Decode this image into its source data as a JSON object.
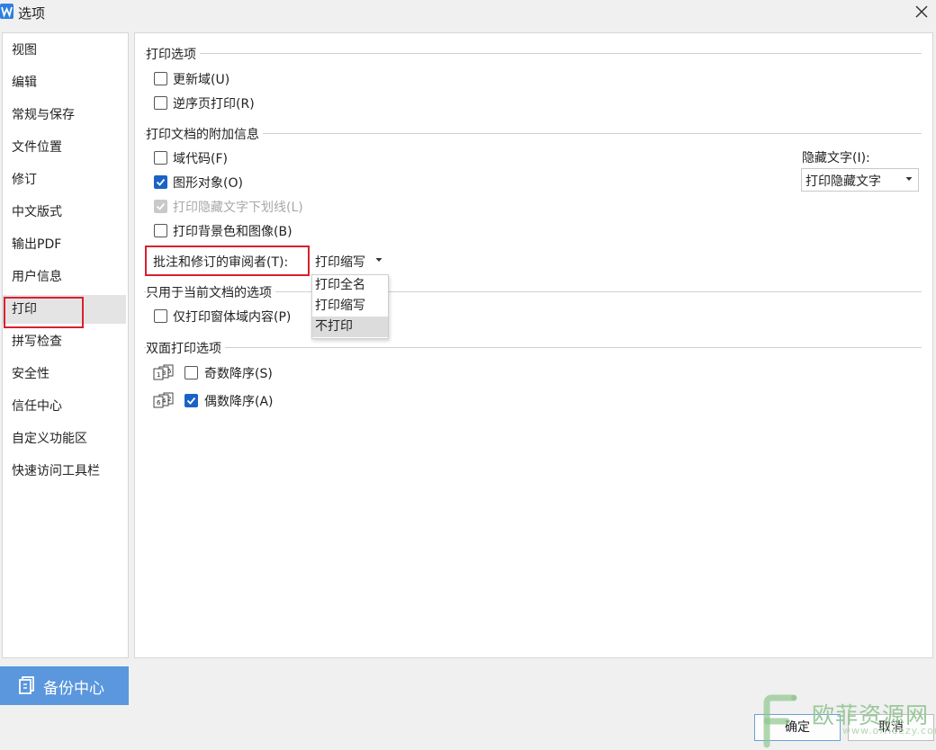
{
  "window": {
    "title": "选项"
  },
  "sidebar": {
    "items": [
      {
        "label": "视图"
      },
      {
        "label": "编辑"
      },
      {
        "label": "常规与保存"
      },
      {
        "label": "文件位置"
      },
      {
        "label": "修订"
      },
      {
        "label": "中文版式"
      },
      {
        "label": "输出PDF"
      },
      {
        "label": "用户信息"
      },
      {
        "label": "打印",
        "selected": true
      },
      {
        "label": "拼写检查"
      },
      {
        "label": "安全性"
      },
      {
        "label": "信任中心"
      },
      {
        "label": "自定义功能区"
      },
      {
        "label": "快速访问工具栏"
      }
    ],
    "backup_label": "备份中心"
  },
  "print_options": {
    "title": "打印选项",
    "update_fields": {
      "label": "更新域(U)",
      "checked": false
    },
    "reverse_order": {
      "label": "逆序页打印(R)",
      "checked": false
    }
  },
  "extra_info": {
    "title": "打印文档的附加信息",
    "field_codes": {
      "label": "域代码(F)",
      "checked": false
    },
    "drawing_objects": {
      "label": "图形对象(O)",
      "checked": true
    },
    "hidden_underline": {
      "label": "打印隐藏文字下划线(L)",
      "checked": true,
      "disabled": true
    },
    "background": {
      "label": "打印背景色和图像(B)",
      "checked": false
    },
    "hidden_text": {
      "label": "隐藏文字(I):",
      "value": "打印隐藏文字"
    },
    "reviewer": {
      "label": "批注和修订的审阅者(T):",
      "value": "打印缩写",
      "options": [
        "打印全名",
        "打印缩写",
        "不打印"
      ],
      "highlighted_option": "不打印"
    }
  },
  "current_doc": {
    "title": "只用于当前文档的选项",
    "form_data": {
      "label": "仅打印窗体域内容(P)",
      "checked": false
    }
  },
  "duplex": {
    "title": "双面打印选项",
    "odd": {
      "label": "奇数降序(S)",
      "checked": false,
      "icon_digits": "135"
    },
    "even": {
      "label": "偶数降序(A)",
      "checked": true,
      "icon_digits": "642"
    }
  },
  "footer": {
    "ok_label": "确定",
    "cancel_label": "取消"
  },
  "watermark": {
    "text": "欧菲资源网",
    "url": "www.officezy.com"
  },
  "colors": {
    "accent": "#1a63c6",
    "highlight_box": "#d9202e",
    "backup_bg": "#5a97dd",
    "selected_bg": "#e4e4e4"
  }
}
